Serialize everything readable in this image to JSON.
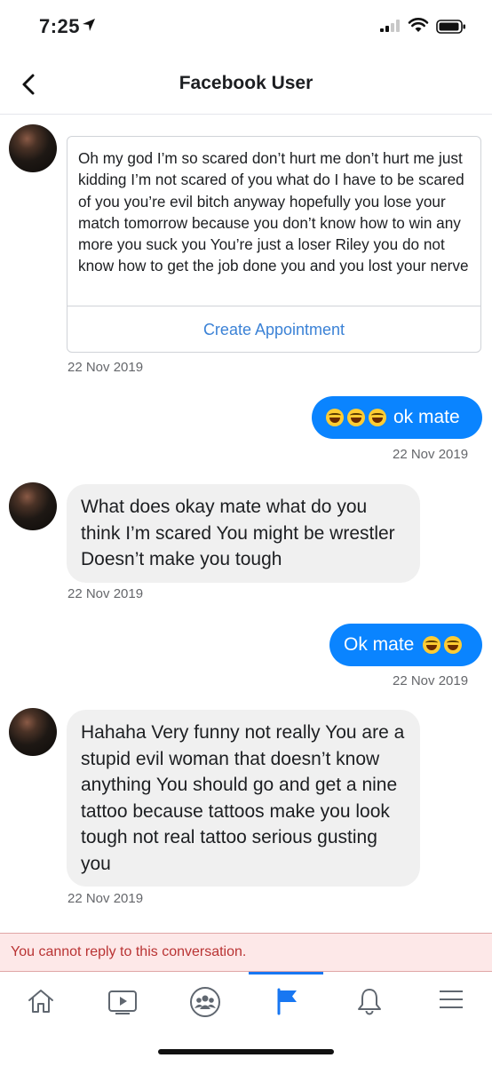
{
  "status_bar": {
    "time": "7:25"
  },
  "header": {
    "title": "Facebook User"
  },
  "messages": [
    {
      "type": "incoming_card",
      "text": "Oh my god I’m so scared don’t hurt me don’t hurt me just kidding I’m not scared of you what do I have to be scared of you you’re evil bitch anyway hopefully you lose your match tomorrow because you don’t know how to win any more you suck you You’re just a loser Riley you do not know how to get the job done you and you lost your nerve",
      "action_label": "Create Appointment",
      "timestamp": "22 Nov 2019"
    },
    {
      "type": "outgoing",
      "text": "ok mate",
      "emoji_count": 3,
      "emoji_position": "before",
      "timestamp": "22 Nov 2019"
    },
    {
      "type": "incoming",
      "text": "What does okay mate what do you think I’m scared You might be wrestler Doesn’t make you tough",
      "timestamp": "22 Nov 2019"
    },
    {
      "type": "outgoing",
      "text": "Ok mate",
      "emoji_count": 2,
      "emoji_position": "after",
      "timestamp": "22 Nov 2019"
    },
    {
      "type": "incoming",
      "text": "Hahaha Very funny not really You are a stupid evil woman that doesn’t know anything You should go and get a nine tattoo because tattoos make you look tough not real tattoo serious gusting you",
      "timestamp": "22 Nov 2019"
    }
  ],
  "banner": {
    "text": "You cannot reply to this conversation."
  },
  "tabs": [
    {
      "icon": "home-icon",
      "active": false
    },
    {
      "icon": "watch-icon",
      "active": false
    },
    {
      "icon": "groups-icon",
      "active": false
    },
    {
      "icon": "pages-flag-icon",
      "active": true
    },
    {
      "icon": "notifications-bell-icon",
      "active": false
    },
    {
      "icon": "menu-icon",
      "active": false
    }
  ],
  "colors": {
    "accent": "#0a84ff",
    "tab_active": "#1877f2",
    "banner_bg": "#fde8e8",
    "banner_text": "#b93333"
  }
}
